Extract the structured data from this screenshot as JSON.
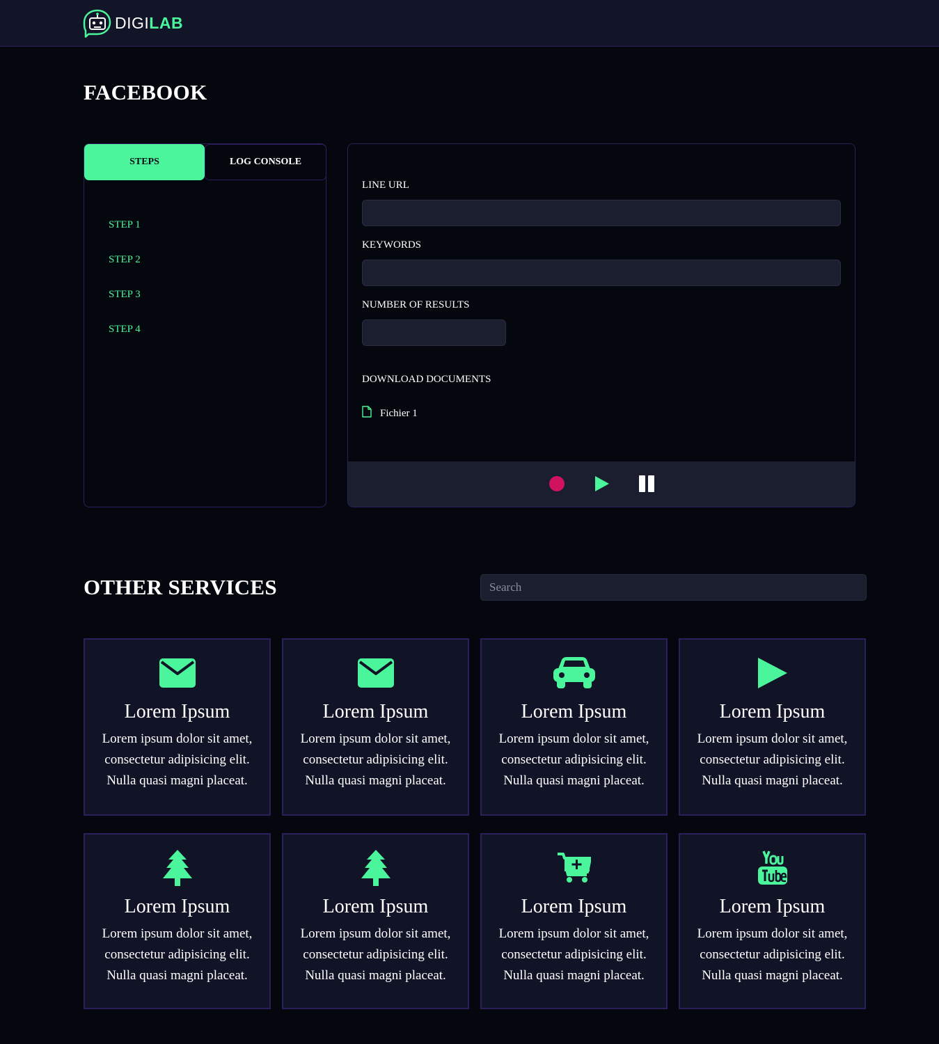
{
  "header": {
    "logo_part1": "DIGI",
    "logo_part2": "LAB",
    "logo_icon": "robot-chat-icon"
  },
  "page_title": "FACEBOOK",
  "tabs": [
    {
      "label": "STEPS",
      "active": true
    },
    {
      "label": "LOG CONSOLE",
      "active": false
    }
  ],
  "steps": [
    "STEP 1",
    "STEP 2",
    "STEP 3",
    "STEP 4"
  ],
  "form": {
    "line_url_label": "LINE URL",
    "line_url_value": "",
    "keywords_label": "KEYWORDS",
    "keywords_value": "",
    "results_label": "NUMBER OF RESULTS",
    "results_value": "",
    "download_label": "DOWNLOAD DOCUMENTS",
    "documents": [
      {
        "name": "Fichier 1",
        "icon": "file-icon"
      }
    ]
  },
  "controls": [
    {
      "name": "record",
      "icon": "record-icon",
      "color": "#d1135f"
    },
    {
      "name": "play",
      "icon": "play-icon",
      "color": "#4bf59c"
    },
    {
      "name": "pause",
      "icon": "pause-icon",
      "color": "#ffffff"
    }
  ],
  "other_services": {
    "title": "OTHER SERVICES",
    "search_placeholder": "Search",
    "cards": [
      {
        "icon": "envelope-icon",
        "title": "Lorem Ipsum",
        "text": "Lorem ipsum dolor sit amet, consectetur adipisicing elit. Nulla quasi magni placeat."
      },
      {
        "icon": "envelope-icon",
        "title": "Lorem Ipsum",
        "text": "Lorem ipsum dolor sit amet, consectetur adipisicing elit. Nulla quasi magni placeat."
      },
      {
        "icon": "car-icon",
        "title": "Lorem Ipsum",
        "text": "Lorem ipsum dolor sit amet, consectetur adipisicing elit. Nulla quasi magni placeat."
      },
      {
        "icon": "play-icon",
        "title": "Lorem Ipsum",
        "text": "Lorem ipsum dolor sit amet, consectetur adipisicing elit. Nulla quasi magni placeat."
      },
      {
        "icon": "tree-icon",
        "title": "Lorem Ipsum",
        "text": "Lorem ipsum dolor sit amet, consectetur adipisicing elit. Nulla quasi magni placeat."
      },
      {
        "icon": "tree-icon",
        "title": "Lorem Ipsum",
        "text": "Lorem ipsum dolor sit amet, consectetur adipisicing elit. Nulla quasi magni placeat."
      },
      {
        "icon": "cart-plus-icon",
        "title": "Lorem Ipsum",
        "text": "Lorem ipsum dolor sit amet, consectetur adipisicing elit. Nulla quasi magni placeat."
      },
      {
        "icon": "youtube-icon",
        "title": "Lorem Ipsum",
        "text": "Lorem ipsum dolor sit amet, consectetur adipisicing elit. Nulla quasi magni placeat."
      }
    ]
  },
  "colors": {
    "accent": "#4bf59c",
    "background": "#05070f",
    "panel": "#111327",
    "border": "#2b1f5c",
    "record": "#d1135f"
  }
}
